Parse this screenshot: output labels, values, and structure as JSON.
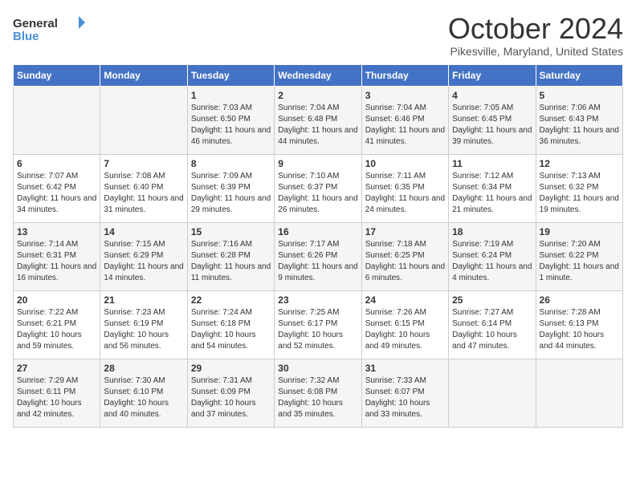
{
  "header": {
    "logo_general": "General",
    "logo_blue": "Blue",
    "month": "October 2024",
    "location": "Pikesville, Maryland, United States"
  },
  "weekdays": [
    "Sunday",
    "Monday",
    "Tuesday",
    "Wednesday",
    "Thursday",
    "Friday",
    "Saturday"
  ],
  "weeks": [
    [
      {
        "date": "",
        "sunrise": "",
        "sunset": "",
        "daylight": ""
      },
      {
        "date": "",
        "sunrise": "",
        "sunset": "",
        "daylight": ""
      },
      {
        "date": "1",
        "sunrise": "Sunrise: 7:03 AM",
        "sunset": "Sunset: 6:50 PM",
        "daylight": "Daylight: 11 hours and 46 minutes."
      },
      {
        "date": "2",
        "sunrise": "Sunrise: 7:04 AM",
        "sunset": "Sunset: 6:48 PM",
        "daylight": "Daylight: 11 hours and 44 minutes."
      },
      {
        "date": "3",
        "sunrise": "Sunrise: 7:04 AM",
        "sunset": "Sunset: 6:46 PM",
        "daylight": "Daylight: 11 hours and 41 minutes."
      },
      {
        "date": "4",
        "sunrise": "Sunrise: 7:05 AM",
        "sunset": "Sunset: 6:45 PM",
        "daylight": "Daylight: 11 hours and 39 minutes."
      },
      {
        "date": "5",
        "sunrise": "Sunrise: 7:06 AM",
        "sunset": "Sunset: 6:43 PM",
        "daylight": "Daylight: 11 hours and 36 minutes."
      }
    ],
    [
      {
        "date": "6",
        "sunrise": "Sunrise: 7:07 AM",
        "sunset": "Sunset: 6:42 PM",
        "daylight": "Daylight: 11 hours and 34 minutes."
      },
      {
        "date": "7",
        "sunrise": "Sunrise: 7:08 AM",
        "sunset": "Sunset: 6:40 PM",
        "daylight": "Daylight: 11 hours and 31 minutes."
      },
      {
        "date": "8",
        "sunrise": "Sunrise: 7:09 AM",
        "sunset": "Sunset: 6:39 PM",
        "daylight": "Daylight: 11 hours and 29 minutes."
      },
      {
        "date": "9",
        "sunrise": "Sunrise: 7:10 AM",
        "sunset": "Sunset: 6:37 PM",
        "daylight": "Daylight: 11 hours and 26 minutes."
      },
      {
        "date": "10",
        "sunrise": "Sunrise: 7:11 AM",
        "sunset": "Sunset: 6:35 PM",
        "daylight": "Daylight: 11 hours and 24 minutes."
      },
      {
        "date": "11",
        "sunrise": "Sunrise: 7:12 AM",
        "sunset": "Sunset: 6:34 PM",
        "daylight": "Daylight: 11 hours and 21 minutes."
      },
      {
        "date": "12",
        "sunrise": "Sunrise: 7:13 AM",
        "sunset": "Sunset: 6:32 PM",
        "daylight": "Daylight: 11 hours and 19 minutes."
      }
    ],
    [
      {
        "date": "13",
        "sunrise": "Sunrise: 7:14 AM",
        "sunset": "Sunset: 6:31 PM",
        "daylight": "Daylight: 11 hours and 16 minutes."
      },
      {
        "date": "14",
        "sunrise": "Sunrise: 7:15 AM",
        "sunset": "Sunset: 6:29 PM",
        "daylight": "Daylight: 11 hours and 14 minutes."
      },
      {
        "date": "15",
        "sunrise": "Sunrise: 7:16 AM",
        "sunset": "Sunset: 6:28 PM",
        "daylight": "Daylight: 11 hours and 11 minutes."
      },
      {
        "date": "16",
        "sunrise": "Sunrise: 7:17 AM",
        "sunset": "Sunset: 6:26 PM",
        "daylight": "Daylight: 11 hours and 9 minutes."
      },
      {
        "date": "17",
        "sunrise": "Sunrise: 7:18 AM",
        "sunset": "Sunset: 6:25 PM",
        "daylight": "Daylight: 11 hours and 6 minutes."
      },
      {
        "date": "18",
        "sunrise": "Sunrise: 7:19 AM",
        "sunset": "Sunset: 6:24 PM",
        "daylight": "Daylight: 11 hours and 4 minutes."
      },
      {
        "date": "19",
        "sunrise": "Sunrise: 7:20 AM",
        "sunset": "Sunset: 6:22 PM",
        "daylight": "Daylight: 11 hours and 1 minute."
      }
    ],
    [
      {
        "date": "20",
        "sunrise": "Sunrise: 7:22 AM",
        "sunset": "Sunset: 6:21 PM",
        "daylight": "Daylight: 10 hours and 59 minutes."
      },
      {
        "date": "21",
        "sunrise": "Sunrise: 7:23 AM",
        "sunset": "Sunset: 6:19 PM",
        "daylight": "Daylight: 10 hours and 56 minutes."
      },
      {
        "date": "22",
        "sunrise": "Sunrise: 7:24 AM",
        "sunset": "Sunset: 6:18 PM",
        "daylight": "Daylight: 10 hours and 54 minutes."
      },
      {
        "date": "23",
        "sunrise": "Sunrise: 7:25 AM",
        "sunset": "Sunset: 6:17 PM",
        "daylight": "Daylight: 10 hours and 52 minutes."
      },
      {
        "date": "24",
        "sunrise": "Sunrise: 7:26 AM",
        "sunset": "Sunset: 6:15 PM",
        "daylight": "Daylight: 10 hours and 49 minutes."
      },
      {
        "date": "25",
        "sunrise": "Sunrise: 7:27 AM",
        "sunset": "Sunset: 6:14 PM",
        "daylight": "Daylight: 10 hours and 47 minutes."
      },
      {
        "date": "26",
        "sunrise": "Sunrise: 7:28 AM",
        "sunset": "Sunset: 6:13 PM",
        "daylight": "Daylight: 10 hours and 44 minutes."
      }
    ],
    [
      {
        "date": "27",
        "sunrise": "Sunrise: 7:29 AM",
        "sunset": "Sunset: 6:11 PM",
        "daylight": "Daylight: 10 hours and 42 minutes."
      },
      {
        "date": "28",
        "sunrise": "Sunrise: 7:30 AM",
        "sunset": "Sunset: 6:10 PM",
        "daylight": "Daylight: 10 hours and 40 minutes."
      },
      {
        "date": "29",
        "sunrise": "Sunrise: 7:31 AM",
        "sunset": "Sunset: 6:09 PM",
        "daylight": "Daylight: 10 hours and 37 minutes."
      },
      {
        "date": "30",
        "sunrise": "Sunrise: 7:32 AM",
        "sunset": "Sunset: 6:08 PM",
        "daylight": "Daylight: 10 hours and 35 minutes."
      },
      {
        "date": "31",
        "sunrise": "Sunrise: 7:33 AM",
        "sunset": "Sunset: 6:07 PM",
        "daylight": "Daylight: 10 hours and 33 minutes."
      },
      {
        "date": "",
        "sunrise": "",
        "sunset": "",
        "daylight": ""
      },
      {
        "date": "",
        "sunrise": "",
        "sunset": "",
        "daylight": ""
      }
    ]
  ]
}
